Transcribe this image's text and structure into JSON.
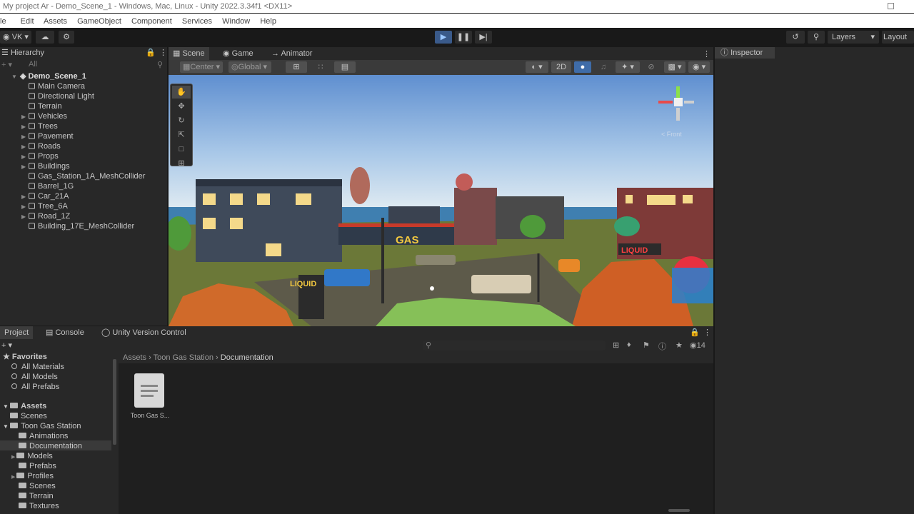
{
  "window": {
    "title": "My project Ar - Demo_Scene_1 - Windows, Mac, Linux - Unity 2022.3.34f1 <DX11>"
  },
  "menu": [
    "le",
    "Edit",
    "Assets",
    "GameObject",
    "Component",
    "Services",
    "Window",
    "Help"
  ],
  "toolbar": {
    "account": "VK",
    "layers": "Layers",
    "layout": "Layout"
  },
  "hierarchy": {
    "title": "Hierarchy",
    "search_placeholder": "All",
    "scene": "Demo_Scene_1",
    "items": [
      "Main Camera",
      "Directional Light",
      "Terrain",
      "Vehicles",
      "Trees",
      "Pavement",
      "Roads",
      "Props",
      "Buildings",
      "Gas_Station_1A_MeshCollider",
      "Barrel_1G",
      "Car_21A",
      "Tree_6A",
      "Road_1Z",
      "Building_17E_MeshCollider"
    ]
  },
  "scene": {
    "tabs": [
      "Scene",
      "Game",
      "Animator"
    ],
    "pivot": "Center",
    "space": "Global",
    "mode2d": "2D",
    "gizmo_label": "< Front",
    "sign_gas": "GAS",
    "sign_liquid": "LIQUID"
  },
  "inspector": {
    "title": "Inspector"
  },
  "project": {
    "tabs": [
      "Project",
      "Console",
      "Unity Version Control"
    ],
    "count": "14",
    "favorites": {
      "title": "Favorites",
      "items": [
        "All Materials",
        "All Models",
        "All Prefabs"
      ]
    },
    "assets": {
      "title": "Assets",
      "items": [
        "Scenes",
        "Toon Gas Station",
        "Animations",
        "Documentation",
        "Models",
        "Prefabs",
        "Profiles",
        "Scenes",
        "Terrain",
        "Textures"
      ]
    },
    "breadcrumb": [
      "Assets",
      "Toon Gas Station",
      "Documentation"
    ],
    "file": "Toon Gas S..."
  },
  "colors": {
    "editor_bg": "#282828",
    "selected_row": "#2c5d87",
    "sky": "#6c9ed9",
    "ground": "#6c7a3c"
  }
}
